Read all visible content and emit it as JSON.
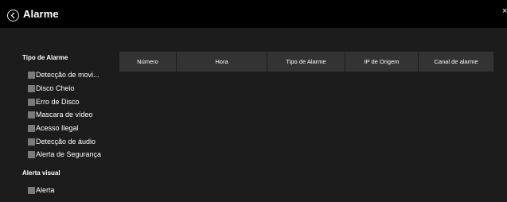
{
  "header": {
    "title": "Alarme",
    "close_label": "×"
  },
  "filters": {
    "alarm_type_title": "Tipo de Alarme",
    "alarm_types": [
      {
        "label": "Detecção de movi...",
        "checked": false
      },
      {
        "label": "Disco Cheio",
        "checked": false
      },
      {
        "label": "Erro de Disco",
        "checked": false
      },
      {
        "label": "Mascara de vídeo",
        "checked": false
      },
      {
        "label": "Acesso Ilegal",
        "checked": false
      },
      {
        "label": "Detecção de áudio",
        "checked": false
      },
      {
        "label": "Alerta de Segurança",
        "checked": false
      }
    ],
    "visual_alert_title": "Alerta visual",
    "visual_alert": {
      "label": "Alerta",
      "checked": false
    }
  },
  "table": {
    "columns": [
      "Número",
      "Hora",
      "Tipo de Alarme",
      "IP de Origem",
      "Canal de alarme"
    ],
    "rows": []
  },
  "colors": {
    "background": "#1c1c1c",
    "header_background": "#000000",
    "table_header": "#333333",
    "checkbox": "#7a7a7a"
  }
}
